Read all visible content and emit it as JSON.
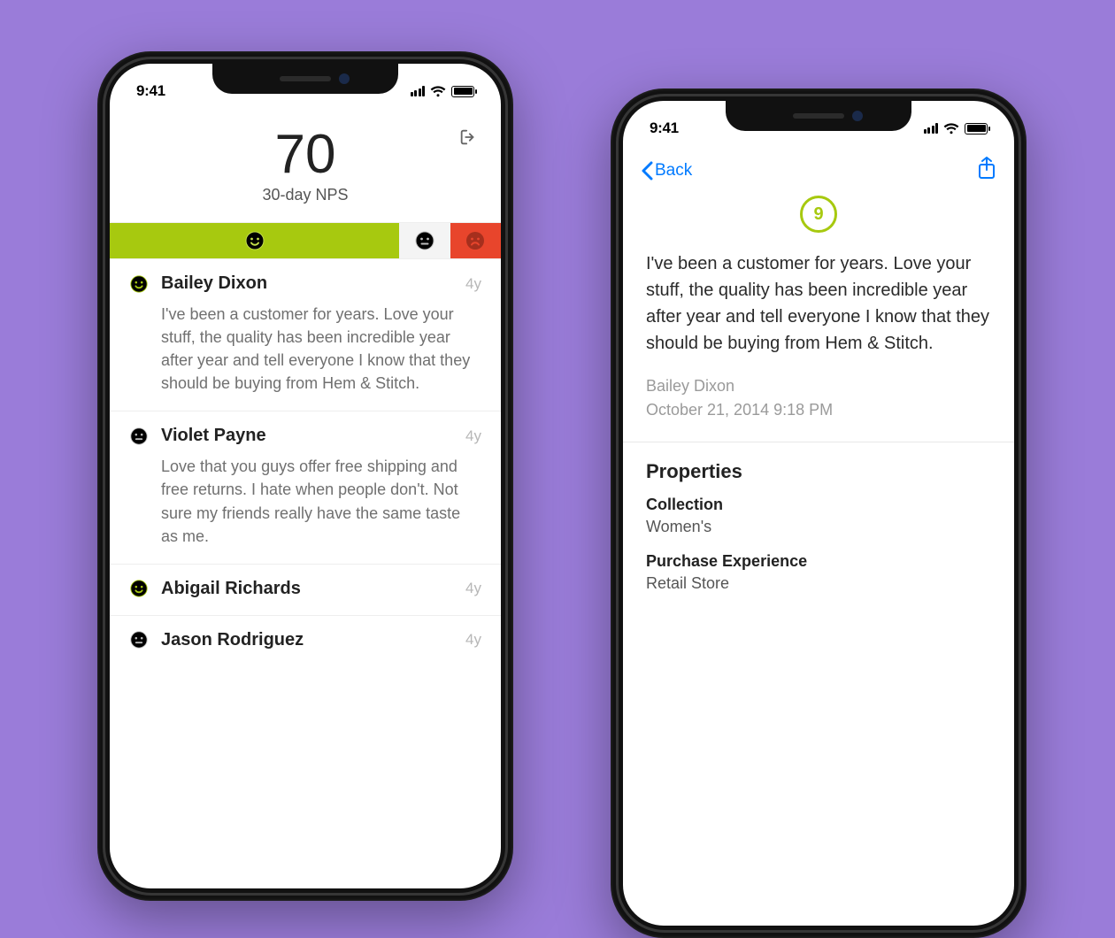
{
  "status": {
    "time": "9:41"
  },
  "left": {
    "score": "70",
    "score_label": "30-day NPS",
    "segments": {
      "happy_pct": 74,
      "neutral_pct": 13,
      "sad_pct": 13
    },
    "items": [
      {
        "sentiment": "happy",
        "name": "Bailey Dixon",
        "age": "4y",
        "text": "I've been a customer for years. Love your stuff, the quality has been incredible year after year and tell everyone I know that they should be buying from Hem & Stitch."
      },
      {
        "sentiment": "neutral",
        "name": "Violet Payne",
        "age": "4y",
        "text": "Love that you guys offer free shipping and free returns. I hate when people don't. Not sure my friends really have the same taste as me."
      },
      {
        "sentiment": "happy",
        "name": "Abigail Richards",
        "age": "4y",
        "text": ""
      },
      {
        "sentiment": "neutral",
        "name": "Jason Rodriguez",
        "age": "4y",
        "text": ""
      }
    ]
  },
  "right": {
    "back_label": "Back",
    "rating": "9",
    "text": "I've been a customer for years. Love your stuff, the quality has been incredible year after year and tell everyone I know that they should be buying from Hem & Stitch.",
    "author": "Bailey Dixon",
    "timestamp": "October 21, 2014 9:18 PM",
    "properties_title": "Properties",
    "properties": [
      {
        "label": "Collection",
        "value": "Women's"
      },
      {
        "label": "Purchase Experience",
        "value": "Retail Store"
      }
    ]
  },
  "colors": {
    "accent": "#a7c90f",
    "danger": "#e8452c",
    "ios_blue": "#007aff"
  }
}
